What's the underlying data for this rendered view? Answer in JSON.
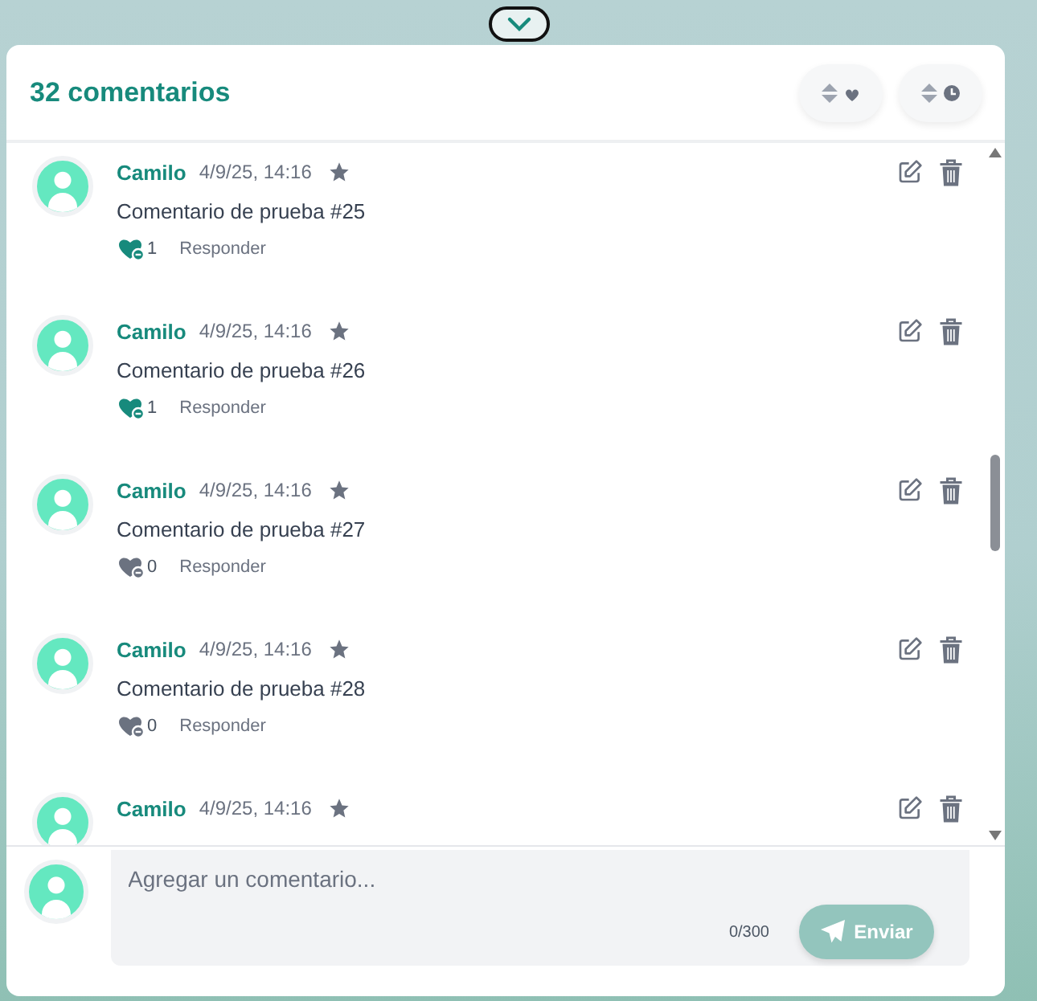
{
  "header": {
    "title": "32 comentarios",
    "sort_buttons": [
      {
        "kind": "likes"
      },
      {
        "kind": "time"
      }
    ]
  },
  "comments": [
    {
      "author": "Camilo",
      "time": "4/9/25, 14:16",
      "text": "Comentario de prueba #25",
      "liked": true,
      "likes": "1",
      "reply": "Responder"
    },
    {
      "author": "Camilo",
      "time": "4/9/25, 14:16",
      "text": "Comentario de prueba #26",
      "liked": true,
      "likes": "1",
      "reply": "Responder"
    },
    {
      "author": "Camilo",
      "time": "4/9/25, 14:16",
      "text": "Comentario de prueba #27",
      "liked": false,
      "likes": "0",
      "reply": "Responder"
    },
    {
      "author": "Camilo",
      "time": "4/9/25, 14:16",
      "text": "Comentario de prueba #28",
      "liked": false,
      "likes": "0",
      "reply": "Responder"
    },
    {
      "author": "Camilo",
      "time": "4/9/25, 14:16"
    }
  ],
  "composer": {
    "placeholder": "Agregar un comentario...",
    "counter": "0/300",
    "send": "Enviar"
  }
}
